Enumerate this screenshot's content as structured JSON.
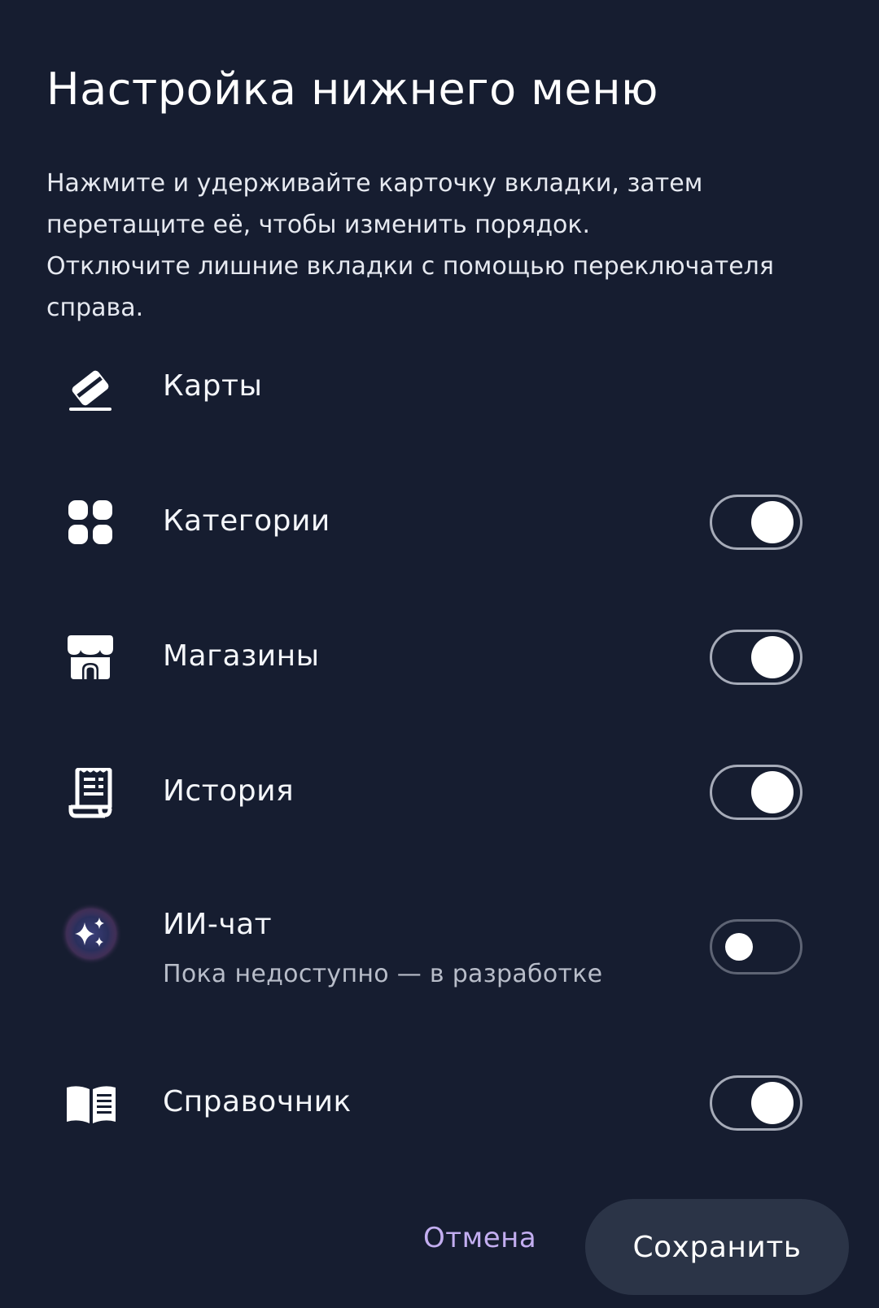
{
  "dialog": {
    "title": "Настройка нижнего меню",
    "description_lines": [
      "Нажмите и удерживайте карточку вкладки, затем",
      "перетащите её, чтобы изменить порядок.",
      "Отключите лишние вкладки с помощью переключателя",
      "справа."
    ]
  },
  "items": [
    {
      "label": "Карты",
      "icon": "card-icon",
      "toggle": null
    },
    {
      "label": "Категории",
      "icon": "grid-icon",
      "toggle": true
    },
    {
      "label": "Магазины",
      "icon": "store-icon",
      "toggle": true
    },
    {
      "label": "История",
      "icon": "receipt-icon",
      "toggle": true
    },
    {
      "label": "ИИ-чат",
      "sublabel": "Пока недоступно — в разработке",
      "icon": "sparkles-icon",
      "toggle": false
    },
    {
      "label": "Справочник",
      "icon": "book-icon",
      "toggle": true
    }
  ],
  "actions": {
    "cancel_label": "Отмена",
    "save_label": "Сохранить"
  },
  "colors": {
    "background": "#161d30",
    "accent_text": "#c3aef0",
    "save_button_bg": "#2b3447"
  }
}
